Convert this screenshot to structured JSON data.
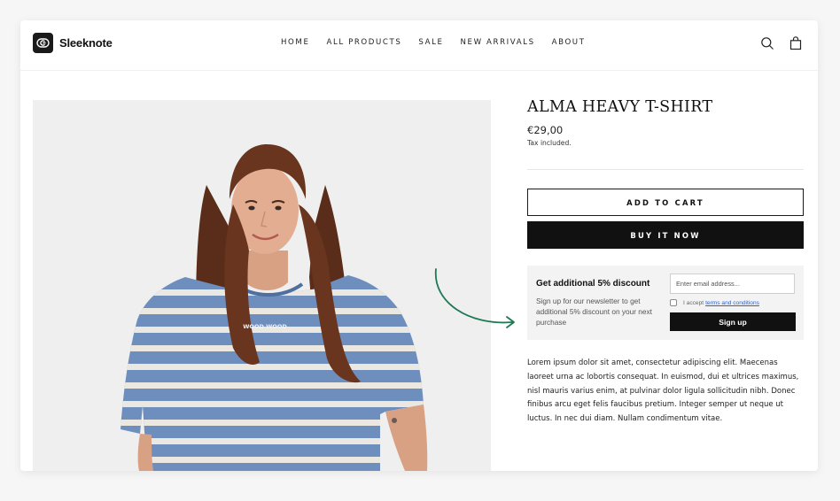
{
  "brand": {
    "name": "Sleeknote"
  },
  "nav": {
    "items": [
      "HOME",
      "ALL PRODUCTS",
      "SALE",
      "NEW ARRIVALS",
      "ABOUT"
    ]
  },
  "header": {
    "icons": [
      "search-icon",
      "shopping-bag-icon"
    ]
  },
  "product": {
    "title": "ALMA HEAVY T-SHIRT",
    "price": "€29,00",
    "tax_note": "Tax included.",
    "add_to_cart_label": "ADD TO CART",
    "buy_now_label": "BUY IT NOW",
    "description": "Lorem ipsum dolor sit amet, consectetur adipiscing elit. Maecenas laoreet urna ac lobortis consequat. In euismod, dui et ultrices maximus, nisl mauris varius enim, at pulvinar dolor ligula sollicitudin nibh. Donec finibus arcu eget felis faucibus pretium. Integer semper ut neque ut luctus. In nec dui diam. Nullam condimentum vitae.",
    "shirt_print": "WOOD WOOD"
  },
  "promo": {
    "title": "Get additional 5% discount",
    "description": "Sign up for our newsletter to get additional 5% discount on your next purchase",
    "email_placeholder": "Enter email address...",
    "email_value": "",
    "accept_text": "I accept",
    "terms_link": "terms and conditions",
    "terms_checked": false,
    "signup_label": "Sign up"
  },
  "colors": {
    "accent_arrow": "#1e7a54",
    "button_dark": "#111111",
    "promo_bg": "#f3f3f3",
    "link": "#2a62d6"
  }
}
